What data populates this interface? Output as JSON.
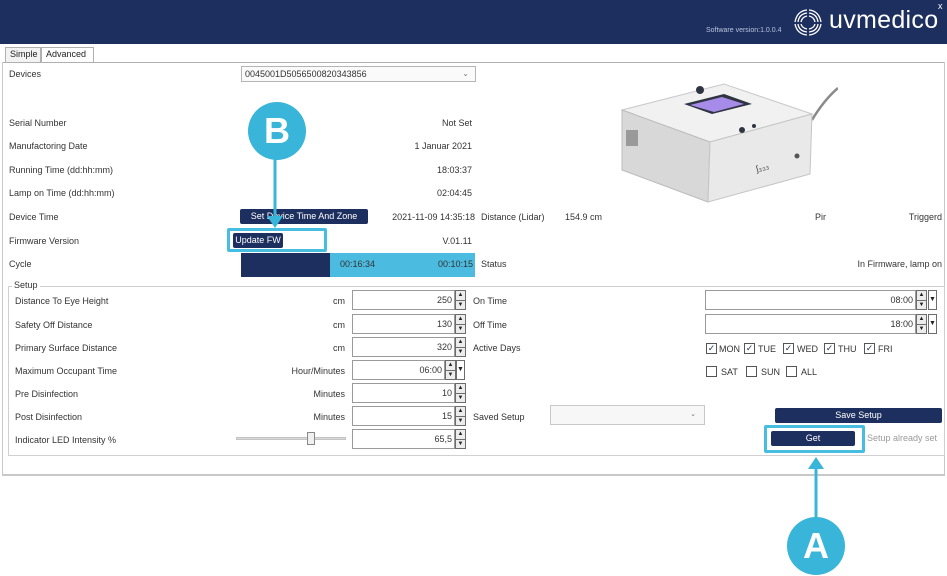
{
  "header": {
    "version": "Software version:1.0.0.4",
    "brand": "uvmedico",
    "close": "x",
    "bg_color": "#1d2f5e"
  },
  "tabs": [
    {
      "label": "Simple",
      "active": false
    },
    {
      "label": "Advanced",
      "active": true
    }
  ],
  "devices": {
    "label": "Devices",
    "selected": "0045001D5056500820343856"
  },
  "info": [
    {
      "label": "Serial Number",
      "value": "Not Set"
    },
    {
      "label": "Manufactoring Date",
      "value": "1 Januar 2021"
    },
    {
      "label": "Running Time (dd:hh:mm)",
      "value": "18:03:37"
    },
    {
      "label": "Lamp on Time (dd:hh:mm)",
      "value": "02:04:45"
    }
  ],
  "device_time": {
    "label": "Device Time",
    "button": "Set Device Time And Zone",
    "value": "2021-11-09 14:35:18"
  },
  "firmware": {
    "label": "Firmware Version",
    "button": "Update FW",
    "value": "V.01.11"
  },
  "cycle": {
    "label": "Cycle",
    "elapsed": "00:16:34",
    "remaining": "00:10:15",
    "progress_fraction": 0.38
  },
  "right_info": {
    "distance_label": "Distance (Lidar)",
    "distance_value": "154.9 cm",
    "pir_label": "Pir",
    "pir_value": "Triggerd",
    "status_label": "Status",
    "status_value": "In Firmware, lamp on"
  },
  "setup": {
    "title": "Setup",
    "rows": [
      {
        "label": "Distance To Eye Height",
        "unit": "cm",
        "value": "250"
      },
      {
        "label": "Safety Off Distance",
        "unit": "cm",
        "value": "130"
      },
      {
        "label": "Primary Surface Distance",
        "unit": "cm",
        "value": "320"
      },
      {
        "label": "Maximum Occupant Time",
        "unit": "Hour/Minutes",
        "value": "06:00"
      },
      {
        "label": "Pre Disinfection",
        "unit": "Minutes",
        "value": "10"
      },
      {
        "label": "Post Disinfection",
        "unit": "Minutes",
        "value": "15"
      },
      {
        "label": "Indicator LED Intensity %",
        "unit": "",
        "value": "65,5"
      }
    ],
    "on_time": {
      "label": "On Time",
      "value": "08:00"
    },
    "off_time": {
      "label": "Off Time",
      "value": "18:00"
    },
    "active_days": {
      "label": "Active Days",
      "days": [
        {
          "label": "MON",
          "checked": true
        },
        {
          "label": "TUE",
          "checked": true
        },
        {
          "label": "WED",
          "checked": true
        },
        {
          "label": "THU",
          "checked": true
        },
        {
          "label": "FRI",
          "checked": true
        },
        {
          "label": "SAT",
          "checked": false
        },
        {
          "label": "SUN",
          "checked": false
        },
        {
          "label": "ALL",
          "checked": false
        }
      ]
    },
    "saved_setup": {
      "label": "Saved Setup",
      "selected": ""
    },
    "save_button": "Save Setup",
    "get_button": "Get",
    "status": "Setup already set",
    "led_intensity_fraction": 0.7
  },
  "callouts": {
    "a": "A",
    "b": "B",
    "color": "#38b5d9"
  }
}
